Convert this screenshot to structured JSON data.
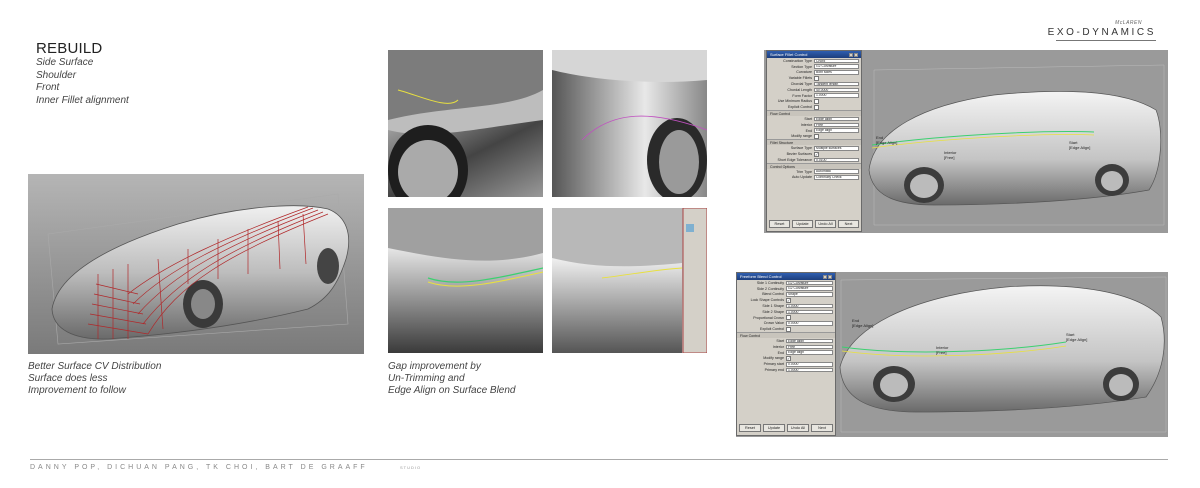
{
  "header": {
    "title": "REBUILD",
    "items": [
      "Side Surface",
      "Shoulder",
      "Front",
      "Inner Fillet alignment"
    ],
    "brand_small": "McLAREN",
    "brand": "EXO-DYNAMICS"
  },
  "left_panel": {
    "caption_lines": [
      "Better Surface CV Distribution",
      "Surface does less",
      "Improvement to follow"
    ]
  },
  "middle_panel": {
    "caption_lines": [
      "Gap improvement  by",
      "Un-Trimming and",
      "Edge Align on Surface Blend"
    ]
  },
  "fillet_dialog": {
    "title": "Surface Fillet Control",
    "rows": [
      {
        "label": "Construction Type",
        "value": "Chord"
      },
      {
        "label": "Section Type",
        "value": "G2 Curvature"
      },
      {
        "label": "Curvature",
        "value": "Both sides"
      },
      {
        "label": "Variable Fillets",
        "value": ""
      },
      {
        "label": "Chordal Type",
        "value": "Tangent length"
      },
      {
        "label": "Chordal Length",
        "value": "40.0000"
      },
      {
        "label": "Form Factor",
        "value": "1.0000"
      },
      {
        "label": "Use Minimum Radius",
        "value": ""
      },
      {
        "label": "Explicit Control",
        "value": ""
      }
    ],
    "flow_section": "Flow Control",
    "flow_rows": [
      {
        "label": "Start",
        "value": "Edge align"
      },
      {
        "label": "Interior",
        "value": "Free"
      },
      {
        "label": "End",
        "value": "Edge align"
      },
      {
        "label": "Modify range",
        "value": ""
      }
    ],
    "structure_section": "Fillet Structure",
    "structure_rows": [
      {
        "label": "Surface Type",
        "value": "Multiple surfaces"
      },
      {
        "label": "Bezier Surfaces",
        "value": "✓"
      },
      {
        "label": "Short Edge Tolerance",
        "value": "0.0100"
      }
    ],
    "control_section": "Control Options",
    "control_rows": [
      {
        "label": "Trim Type",
        "value": "Automatic"
      },
      {
        "label": "Auto Update",
        "value": "Continuity Check"
      }
    ],
    "buttons": [
      "Reset",
      "Update",
      "Undo All",
      "Next"
    ]
  },
  "blend_dialog": {
    "title": "Freeform Blend Control",
    "rows": [
      {
        "label": "Side 1 Continuity",
        "value": "G2 Curvature"
      },
      {
        "label": "Side 2 Continuity",
        "value": "G2 Curvature"
      },
      {
        "label": "Blend Control",
        "value": "Shape"
      },
      {
        "label": "Lock Shape Controls",
        "value": "✓"
      },
      {
        "label": "Side 1 Shape",
        "value": "1.0000"
      },
      {
        "label": "Side 2 Shape",
        "value": "1.0000"
      },
      {
        "label": "Proportional Crown",
        "value": ""
      },
      {
        "label": "Crown Value",
        "value": "0.0000"
      },
      {
        "label": "Explicit Control",
        "value": ""
      }
    ],
    "flow_section": "Flow Control",
    "flow_rows": [
      {
        "label": "Start",
        "value": "Edge align"
      },
      {
        "label": "Interior",
        "value": "Free"
      },
      {
        "label": "End",
        "value": "Edge align"
      },
      {
        "label": "Modify range",
        "value": "✓"
      },
      {
        "label": "Primary start",
        "value": "0.0000"
      },
      {
        "label": "Primary end",
        "value": "1.0000"
      }
    ],
    "buttons": [
      "Reset",
      "Update",
      "Undo All",
      "Next"
    ]
  },
  "viewport_labels": {
    "top_start": "Start\n[Edge Align]",
    "top_interior": "Interior\n[Free]",
    "top_end": "End\n[Edge Align]",
    "bottom_end": "End\n[Edge Align]",
    "bottom_interior": "Interior\n[Free]",
    "bottom_start": "Start\n[Edge Align]"
  },
  "footer": {
    "names": "DANNY POP, DICHUAN PANG, TK CHOI, BART DE GRAAFF",
    "studio": "STUDIO"
  },
  "colors": {
    "viewport_bg": "#9a9a9a",
    "car_body": "#cfcfcf",
    "cv_mesh": "#b0282a",
    "edge_green": "#3cd070",
    "edge_yellow": "#e8e040",
    "title_bar": "#1d3e7c"
  }
}
